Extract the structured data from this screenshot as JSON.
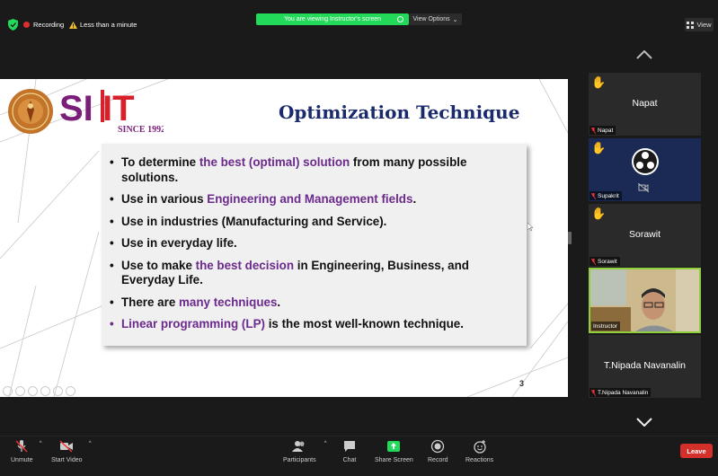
{
  "top_bar": {
    "recording_label": "Recording",
    "duration_warning": "Less than a minute",
    "viewing_banner": "You are viewing Instructor's screen",
    "view_options_label": "View Options",
    "view_button_label": "View"
  },
  "slide": {
    "title": "Optimization Technique",
    "logo_year": "SINCE 1992",
    "page_number": "3",
    "bullets": [
      {
        "pre": "To determine ",
        "hl": "the best (optimal) solution",
        "post": " from many possible solutions."
      },
      {
        "pre": "Use in various ",
        "hl": "Engineering and Management fields",
        "post": "."
      },
      {
        "pre": "Use in industries (Manufacturing and Service).",
        "hl": "",
        "post": ""
      },
      {
        "pre": "Use in everyday life.",
        "hl": "",
        "post": ""
      },
      {
        "pre": "Use to make ",
        "hl": "the best decision",
        "post": " in Engineering, Business, and Everyday Life."
      },
      {
        "pre": "There are ",
        "hl": "many techniques",
        "post": "."
      },
      {
        "pre": "",
        "hl": "Linear programming (LP)",
        "post": " is the most well-known technique."
      }
    ]
  },
  "participants_panel": {
    "tiles": [
      {
        "center_name": "Napat",
        "label": "Napat",
        "hand_raised": true
      },
      {
        "center_name": "",
        "label": "Supakrit",
        "hand_raised": true
      },
      {
        "center_name": "Sorawit",
        "label": "Sorawit",
        "hand_raised": true
      },
      {
        "center_name": "",
        "label": "Instructor",
        "hand_raised": false
      },
      {
        "center_name": "T.Nipada Navanalin",
        "label": "T.Nipada Navanalin",
        "hand_raised": false
      }
    ]
  },
  "toolbar": {
    "unmute_label": "Unmute",
    "start_video_label": "Start Video",
    "participants_label": "Participants",
    "participants_count": "48",
    "chat_label": "Chat",
    "share_screen_label": "Share Screen",
    "record_label": "Record",
    "reactions_label": "Reactions",
    "leave_label": "Leave"
  },
  "colors": {
    "accent_green": "#23d959",
    "leave_red": "#d4302b",
    "slide_title": "#1a2a6c",
    "highlight_purple": "#6b2a8c"
  }
}
